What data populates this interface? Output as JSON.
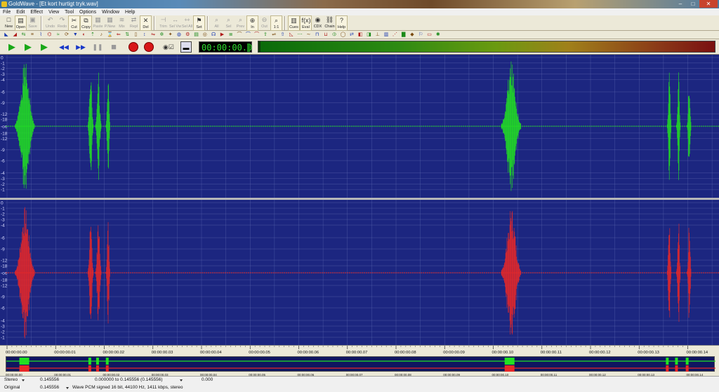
{
  "window": {
    "title": "GoldWave - [Et kort hurtigt tryk.wav]"
  },
  "menu": [
    "File",
    "Edit",
    "Effect",
    "View",
    "Tool",
    "Options",
    "Window",
    "Help"
  ],
  "toolbar": {
    "buttons": [
      {
        "label": "New",
        "icon": "new-file-icon",
        "glyph": "□",
        "enabled": true
      },
      {
        "label": "Open",
        "icon": "open-folder-icon",
        "glyph": "▤",
        "enabled": true,
        "highlight": true
      },
      {
        "label": "Save",
        "icon": "save-disk-icon",
        "glyph": "▣",
        "enabled": false
      },
      {
        "sep": true
      },
      {
        "label": "Undo",
        "icon": "undo-icon",
        "glyph": "↶",
        "enabled": false
      },
      {
        "label": "Redo",
        "icon": "redo-icon",
        "glyph": "↷",
        "enabled": false
      },
      {
        "label": "Cut",
        "icon": "cut-scissors-icon",
        "glyph": "✂",
        "enabled": true,
        "highlight": true
      },
      {
        "label": "Copy",
        "icon": "copy-icon",
        "glyph": "⧉",
        "enabled": true,
        "highlight": true
      },
      {
        "label": "Paste",
        "icon": "paste-icon",
        "glyph": "▦",
        "enabled": false
      },
      {
        "label": "P.New",
        "icon": "paste-new-icon",
        "glyph": "▦",
        "enabled": false
      },
      {
        "label": "Mix",
        "icon": "mix-icon",
        "glyph": "≋",
        "enabled": false
      },
      {
        "label": "Repl",
        "icon": "replace-icon",
        "glyph": "⇄",
        "enabled": false
      },
      {
        "label": "Del",
        "icon": "delete-icon",
        "glyph": "✕",
        "enabled": true,
        "highlight": true
      },
      {
        "sep": true
      },
      {
        "label": "Trim",
        "icon": "trim-icon",
        "glyph": "⊣",
        "enabled": false
      },
      {
        "label": "Sel Vw",
        "icon": "select-view-icon",
        "glyph": "↔",
        "enabled": false
      },
      {
        "label": "Sel All",
        "icon": "select-all-icon",
        "glyph": "⇿",
        "enabled": false
      },
      {
        "label": "Set",
        "icon": "set-marker-icon",
        "glyph": "⚑",
        "enabled": true,
        "highlight": true
      },
      {
        "sep": true
      },
      {
        "label": "All",
        "icon": "zoom-all-icon",
        "glyph": "⌕",
        "enabled": false
      },
      {
        "label": "Sel",
        "icon": "zoom-selection-icon",
        "glyph": "⌕",
        "enabled": false
      },
      {
        "label": "Prev",
        "icon": "zoom-previous-icon",
        "glyph": "⌕",
        "enabled": false
      },
      {
        "label": "In",
        "icon": "zoom-in-icon",
        "glyph": "⊕",
        "enabled": true,
        "highlight": true
      },
      {
        "label": "Out",
        "icon": "zoom-out-icon",
        "glyph": "⊖",
        "enabled": false
      },
      {
        "label": "1:1",
        "icon": "zoom-actual-icon",
        "glyph": "⌕",
        "enabled": true,
        "highlight": true
      },
      {
        "sep": true
      },
      {
        "label": "Cues",
        "icon": "cues-icon",
        "glyph": "▥",
        "enabled": true,
        "highlight": true
      },
      {
        "label": "Eval",
        "icon": "evaluate-icon",
        "glyph": "f(x)",
        "enabled": true,
        "highlight": true
      },
      {
        "label": "CDX",
        "icon": "cd-extract-icon",
        "glyph": "◉",
        "enabled": true
      },
      {
        "label": "Chain",
        "icon": "batch-chain-icon",
        "glyph": "⛓",
        "enabled": true
      },
      {
        "label": "Help",
        "icon": "help-icon",
        "glyph": "?",
        "enabled": true,
        "highlight": true
      }
    ]
  },
  "effects_toolbar": {
    "icons": [
      "fade-in-icon",
      "fade-out-icon",
      "pan-icon",
      "equalizer-icon",
      "filter-icon",
      "echo-icon",
      "flanger-icon",
      "reverb-icon",
      "compressor-icon",
      "volume-icon",
      "normalize-icon",
      "pitch-icon",
      "time-warp-icon",
      "reverse-icon",
      "invert-icon",
      "silence-icon",
      "offset-icon",
      "resample-icon",
      "noise-reduction-icon",
      "pop-click-icon",
      "doppler-icon",
      "mechanize-icon",
      "channel-mixer-icon",
      "spatial-icon",
      "voice-icon",
      "playback-rate-icon",
      "parametric-eq-icon",
      "band-pass-icon",
      "low-pass-icon",
      "high-pass-icon",
      "auto-gain-icon",
      "match-volume-icon",
      "maximize-icon",
      "fade-shape-icon",
      "interpolate-icon",
      "smoother-icon",
      "noise-gate-icon",
      "expander-icon",
      "stereo-icon",
      "mono-icon",
      "swap-channels-icon",
      "channel-left-icon",
      "channel-right-icon",
      "dc-offset-icon",
      "bit-depth-icon",
      "dither-icon",
      "spectrum-icon",
      "cue-points-icon",
      "markers-icon",
      "selection-icon",
      "settings-icon"
    ],
    "glyphs": [
      "◣",
      "◢",
      "⇆",
      "≡",
      "⌇",
      "⌬",
      "≈",
      "⟳",
      "▼",
      "◐",
      "⇡",
      "♪",
      "⌛",
      "⇐",
      "⇅",
      "▯",
      "↕",
      "⇋",
      "✲",
      "✦",
      "◍",
      "⚙",
      "▤",
      "◎",
      "☊",
      "▶",
      "≣",
      "⌒",
      "⌒",
      "⌒",
      "⇪",
      "⇌",
      "⇧",
      "◺",
      "⋯",
      "∼",
      "⊓",
      "⊔",
      "⦶",
      "◯",
      "⇄",
      "◧",
      "◨",
      "⊥",
      "▥",
      "⋰",
      "▇",
      "◆",
      "⚐",
      "▭",
      "✱"
    ]
  },
  "transport": {
    "time": "00:00:00.0",
    "buttons": [
      {
        "name": "play-all-button",
        "glyph": "▶",
        "color": "#18a818"
      },
      {
        "name": "play-selection-button",
        "glyph": "▶",
        "color": "#18a818"
      },
      {
        "name": "play-from-cursor-button",
        "glyph": "▶",
        "color": "#18a818"
      },
      {
        "name": "rewind-button",
        "glyph": "◀◀",
        "color": "#1838c8"
      },
      {
        "name": "fast-forward-button",
        "glyph": "▶▶",
        "color": "#1838c8"
      },
      {
        "name": "pause-button",
        "glyph": "❚❚",
        "color": "#9a9a9a"
      },
      {
        "name": "stop-button",
        "glyph": "■",
        "color": "#9a9a9a"
      }
    ]
  },
  "wave": {
    "background": "#1c2680",
    "grid_color": "#6a74b8",
    "left_color": "#22e022",
    "right_color": "#e82828",
    "db_labels": [
      "0",
      "-1",
      "-2",
      "-3",
      "-4",
      "-6",
      "-9",
      "-12",
      "-18",
      "-oo",
      "-18",
      "-12",
      "-9",
      "-6",
      "-4",
      "-3",
      "-2",
      "-1"
    ],
    "burst_positions": [
      0.0036,
      0.0036,
      0.0037,
      0.0038,
      0.0174,
      0.0189,
      0.0208,
      0.1035,
      0.1046,
      0.1058,
      0.136,
      0.138,
      0.14
    ],
    "duration": 0.145556
  },
  "ruler": {
    "labels": [
      "00:00:00.00",
      "00:00:00.01",
      "00:00:00.02",
      "00:00:00.03",
      "00:00:00.04",
      "00:00:00.05",
      "00:00:00.06",
      "00:00:00.07",
      "00:00:00.08",
      "00:00:00.09",
      "00:00:00.10",
      "00:00:00.11",
      "00:00:00.12",
      "00:00:00.13",
      "00:00:00.14"
    ]
  },
  "status": {
    "channels": "Stereo",
    "length": "0.145556",
    "selection": "0.000000 to 0.145556 (0.145556)",
    "cursor": "0.000",
    "mode": "Original",
    "original_length": "0.145556",
    "format": "Wave PCM signed 16 bit, 44100 Hz, 1411 kbps, stereo"
  }
}
